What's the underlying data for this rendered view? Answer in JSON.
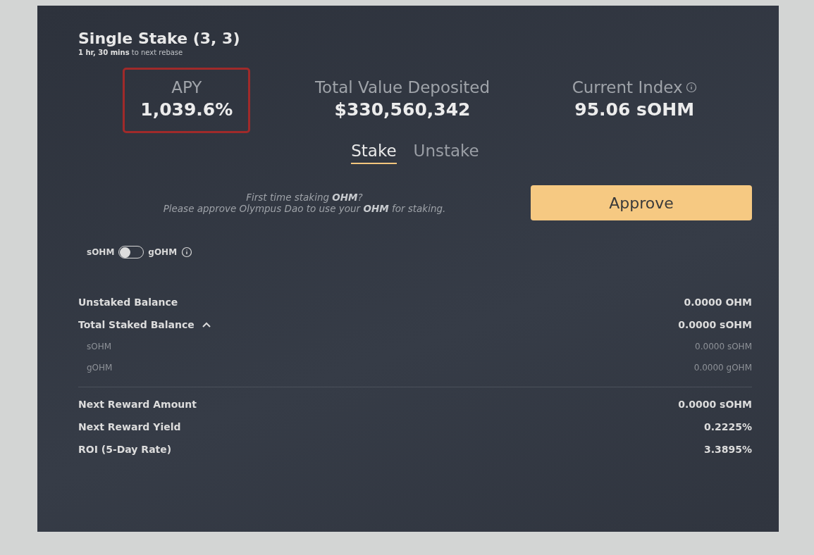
{
  "card": {
    "title": "Single Stake (3, 3)",
    "subtitle": "**1 hr, 30 mins** to next rebase"
  },
  "metrics": [
    {
      "label": "APY",
      "value": "1,039.6%",
      "highlighted": true,
      "info": false
    },
    {
      "label": "Total Value Deposited",
      "value": "$330,560,342",
      "info": false
    },
    {
      "label": "Current Index",
      "value": "95.06 sOHM",
      "info": true
    }
  ],
  "tabs": [
    {
      "label": "Stake",
      "selected": true
    },
    {
      "label": "Unstake",
      "selected": false
    }
  ],
  "approval": {
    "lines": [
      "First time staking **OHM**?",
      "Please approve Olympus Dao to use your **OHM** for staking."
    ],
    "button": "Approve"
  },
  "toggle": {
    "left_label": "sOHM",
    "right_label": "gOHM",
    "checked": false
  },
  "balances": [
    {
      "label": "Unstaked Balance",
      "value": "0.0000 OHM"
    },
    {
      "label": "Total Staked Balance",
      "value": "0.0000 sOHM",
      "expanded": true,
      "children": [
        {
          "label": "sOHM",
          "value": "0.0000 sOHM"
        },
        {
          "label": "gOHM",
          "value": "0.0000 gOHM"
        }
      ]
    }
  ],
  "rewards": [
    {
      "label": "Next Reward Amount",
      "value": "0.0000 sOHM"
    },
    {
      "label": "Next Reward Yield",
      "value": "0.2225%"
    },
    {
      "label": "ROI (5-Day Rate)",
      "value": "3.3895%"
    }
  ]
}
